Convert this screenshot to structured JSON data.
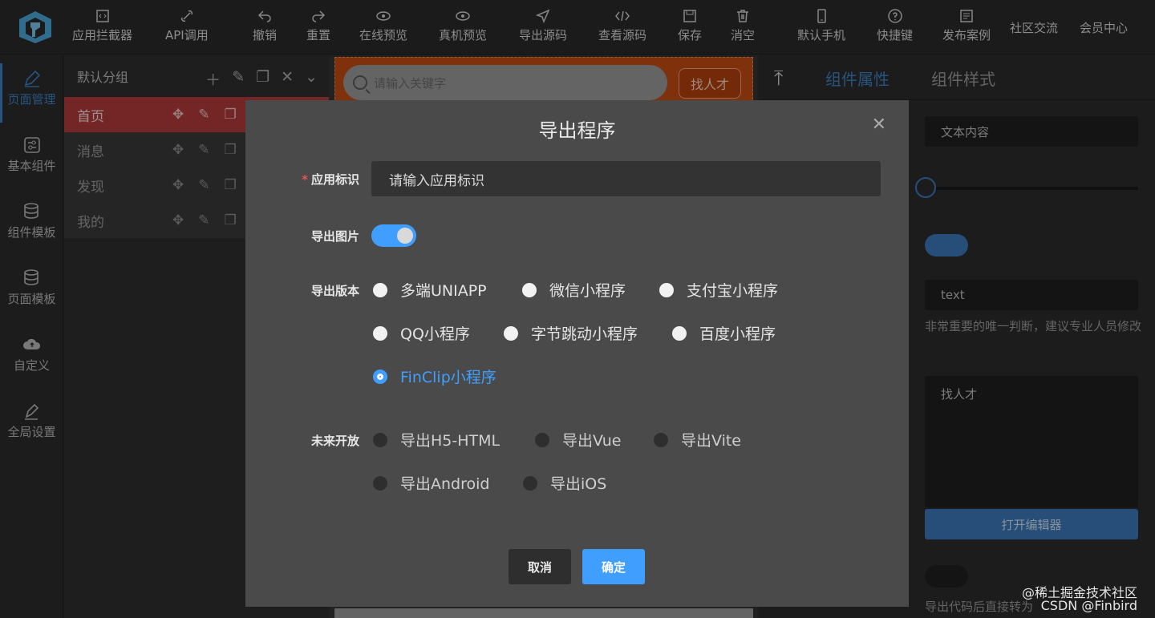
{
  "toolbar": {
    "items": [
      {
        "label": "应用拦截器",
        "icon": "code-file-icon"
      },
      {
        "label": "API调用",
        "icon": "link-icon"
      },
      {
        "label": "撤销",
        "icon": "undo-icon"
      },
      {
        "label": "重置",
        "icon": "redo-icon"
      },
      {
        "label": "在线预览",
        "icon": "eye-icon"
      },
      {
        "label": "真机预览",
        "icon": "eye-icon"
      },
      {
        "label": "导出源码",
        "icon": "send-icon"
      },
      {
        "label": "查看源码",
        "icon": "code-icon"
      },
      {
        "label": "保存",
        "icon": "save-icon"
      },
      {
        "label": "消空",
        "icon": "trash-icon"
      },
      {
        "label": "默认手机",
        "icon": "phone-icon"
      },
      {
        "label": "快捷键",
        "icon": "help-icon"
      },
      {
        "label": "发布案例",
        "icon": "publish-icon"
      }
    ],
    "community": "社区交流",
    "member": "会员中心"
  },
  "sidebar": {
    "items": [
      {
        "label": "页面管理",
        "icon": "edit-icon"
      },
      {
        "label": "基本组件",
        "icon": "component-icon"
      },
      {
        "label": "组件模板",
        "icon": "database-icon"
      },
      {
        "label": "页面模板",
        "icon": "database-icon"
      },
      {
        "label": "自定义",
        "icon": "cloud-icon"
      },
      {
        "label": "全局设置",
        "icon": "pen-icon"
      }
    ]
  },
  "pages": {
    "group": "默认分组",
    "list": [
      "首页",
      "消息",
      "发现",
      "我的"
    ]
  },
  "canvas": {
    "search_placeholder": "请输入关键字",
    "find_button": "找人才"
  },
  "props": {
    "tabs": [
      "组件属性",
      "组件样式"
    ],
    "text_field": "文本内容",
    "id_field": "text",
    "note": "非常重要的唯一判断，建议专业人员修改",
    "textarea": "找人才",
    "editor_button": "打开编辑器",
    "bottom_note": "导出代码后直接转为"
  },
  "modal": {
    "title": "导出程序",
    "app_id_label": "应用标识",
    "app_id_placeholder": "请输入应用标识",
    "export_image_label": "导出图片",
    "export_image_on": true,
    "version_label": "导出版本",
    "versions": [
      "多端UNIAPP",
      "微信小程序",
      "支付宝小程序",
      "QQ小程序",
      "字节跳动小程序",
      "百度小程序",
      "FinClip小程序"
    ],
    "selected_version": "FinClip小程序",
    "future_label": "未来开放",
    "future": [
      "导出H5-HTML",
      "导出Vue",
      "导出Vite",
      "导出Android",
      "导出iOS"
    ],
    "cancel": "取消",
    "confirm": "确定"
  },
  "watermark": {
    "line1": "@稀土掘金技术社区",
    "line2": "CSDN @Finbird"
  }
}
